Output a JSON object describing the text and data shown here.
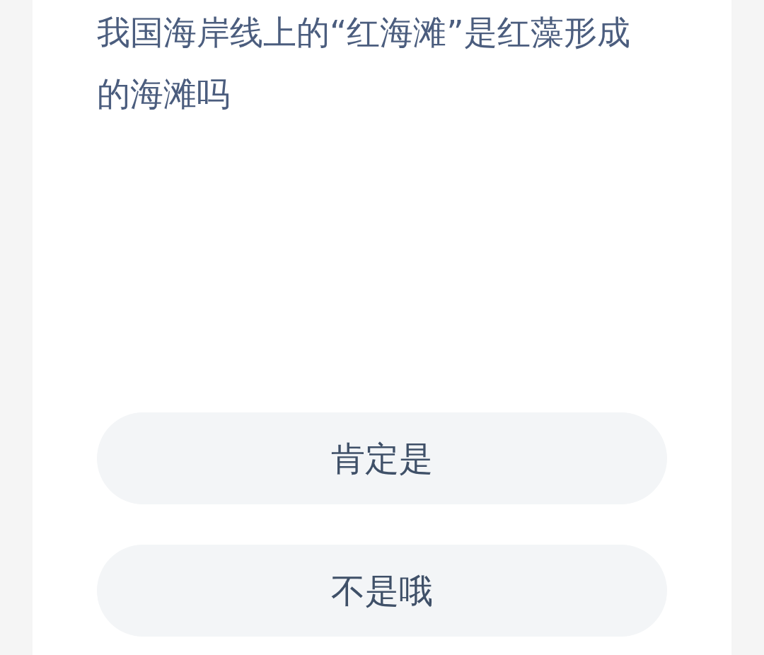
{
  "question": "我国海岸线上的“红海滩”是红藻形成的海滩吗",
  "options": [
    {
      "label": "肯定是"
    },
    {
      "label": "不是哦"
    }
  ]
}
